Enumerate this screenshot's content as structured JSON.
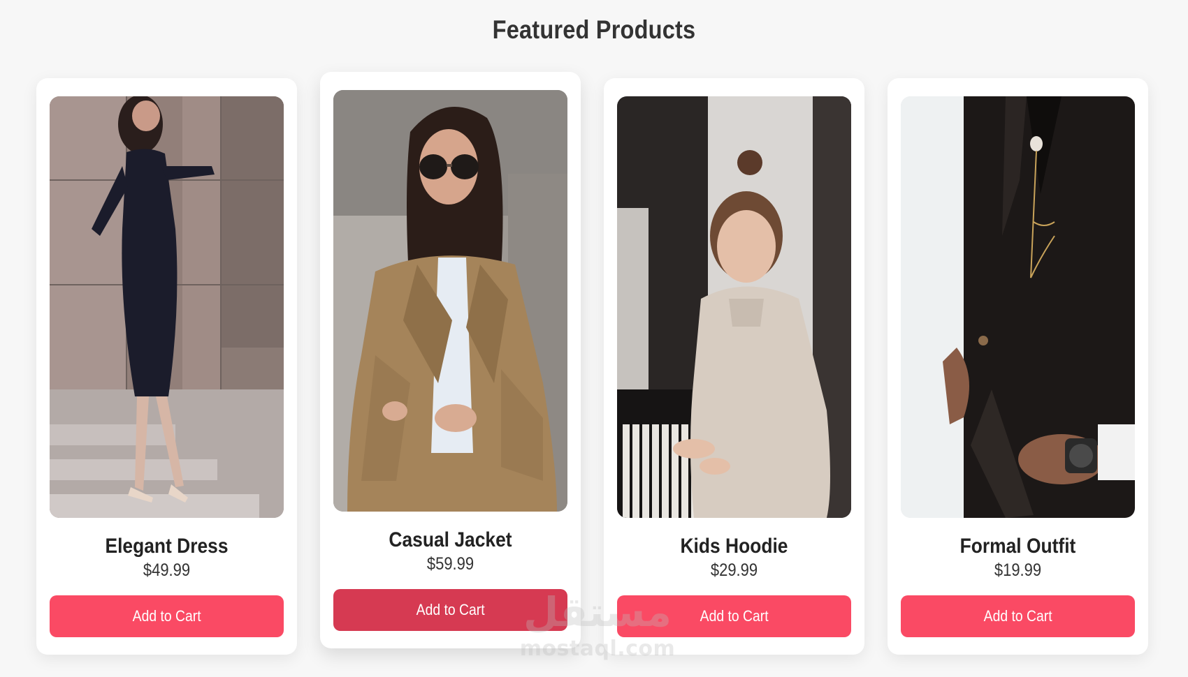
{
  "page": {
    "title": "Featured Products"
  },
  "products": [
    {
      "name": "Elegant Dress",
      "price": "$49.99",
      "button_label": "Add to Cart",
      "image_alt": "Woman in black long-sleeve dress"
    },
    {
      "name": "Casual Jacket",
      "price": "$59.99",
      "button_label": "Add to Cart",
      "image_alt": "Woman in beige trench jacket with sunglasses"
    },
    {
      "name": "Kids Hoodie",
      "price": "$29.99",
      "button_label": "Add to Cart",
      "image_alt": "Girl in cream hoodie at a piano"
    },
    {
      "name": "Formal Outfit",
      "price": "$19.99",
      "button_label": "Add to Cart",
      "image_alt": "Man in black suit with lapel chain"
    }
  ],
  "watermark": {
    "logo": "مستقل",
    "text": "mostaql.com"
  },
  "colors": {
    "background": "#f7f7f7",
    "button": "#fa4a64",
    "button_hover": "#d63a52",
    "title": "#333333"
  }
}
